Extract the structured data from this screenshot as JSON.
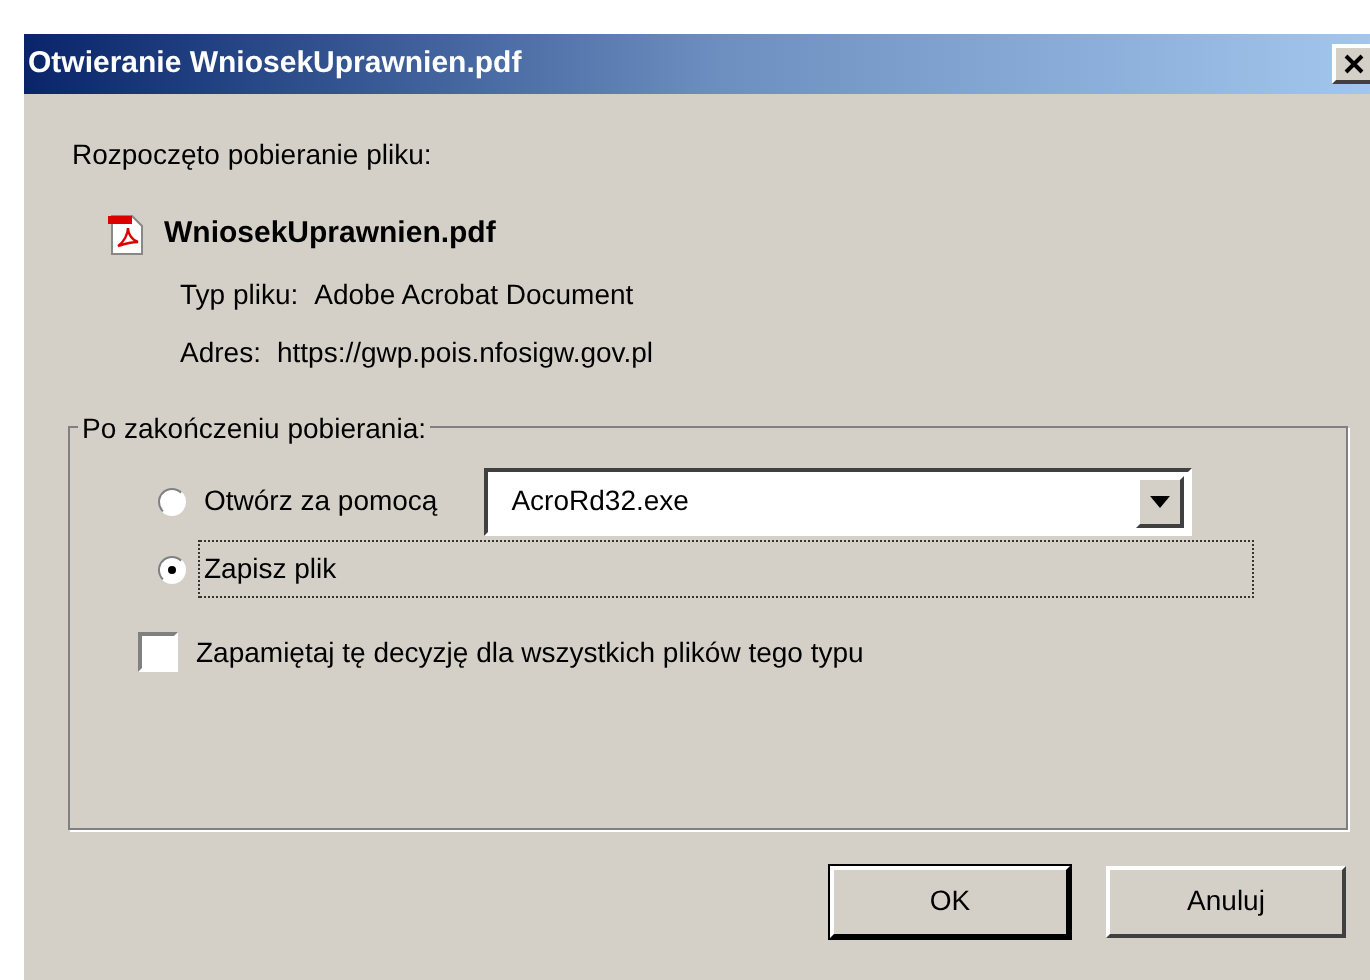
{
  "window": {
    "title": "Otwieranie WniosekUprawnien.pdf"
  },
  "intro": "Rozpoczęto pobieranie pliku:",
  "file": {
    "name": "WniosekUprawnien.pdf",
    "type_label": "Typ pliku:",
    "type": "Adobe Acrobat Document",
    "address_label": "Adres:",
    "address": "https://gwp.pois.nfosigw.gov.pl"
  },
  "group": {
    "legend": "Po zakończeniu pobierania:",
    "options": [
      {
        "label": "Otwórz za pomocą",
        "selected": false,
        "focused": false,
        "application": "AcroRd32.exe"
      },
      {
        "label": "Zapisz plik",
        "selected": true,
        "focused": true
      }
    ],
    "remember": {
      "label": "Zapamiętaj tę decyzję dla wszystkich plików tego typu",
      "checked": false
    }
  },
  "buttons": [
    "OK",
    "Anuluj"
  ]
}
